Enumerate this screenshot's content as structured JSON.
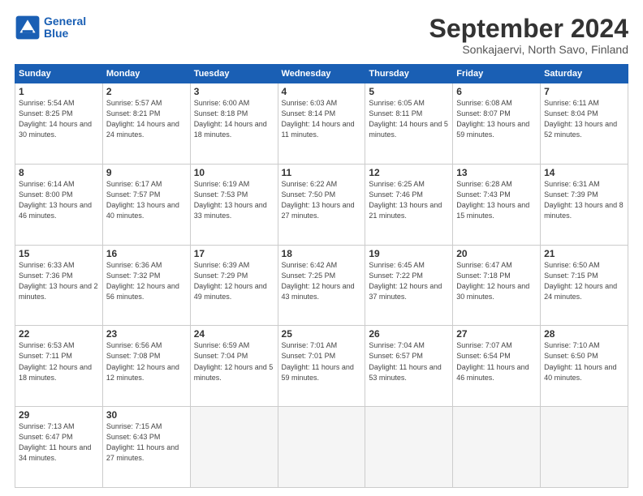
{
  "header": {
    "logo_line1": "General",
    "logo_line2": "Blue",
    "month": "September 2024",
    "location": "Sonkajaervi, North Savo, Finland"
  },
  "weekdays": [
    "Sunday",
    "Monday",
    "Tuesday",
    "Wednesday",
    "Thursday",
    "Friday",
    "Saturday"
  ],
  "days": [
    {
      "num": "1",
      "sunrise": "Sunrise: 5:54 AM",
      "sunset": "Sunset: 8:25 PM",
      "daylight": "Daylight: 14 hours and 30 minutes."
    },
    {
      "num": "2",
      "sunrise": "Sunrise: 5:57 AM",
      "sunset": "Sunset: 8:21 PM",
      "daylight": "Daylight: 14 hours and 24 minutes."
    },
    {
      "num": "3",
      "sunrise": "Sunrise: 6:00 AM",
      "sunset": "Sunset: 8:18 PM",
      "daylight": "Daylight: 14 hours and 18 minutes."
    },
    {
      "num": "4",
      "sunrise": "Sunrise: 6:03 AM",
      "sunset": "Sunset: 8:14 PM",
      "daylight": "Daylight: 14 hours and 11 minutes."
    },
    {
      "num": "5",
      "sunrise": "Sunrise: 6:05 AM",
      "sunset": "Sunset: 8:11 PM",
      "daylight": "Daylight: 14 hours and 5 minutes."
    },
    {
      "num": "6",
      "sunrise": "Sunrise: 6:08 AM",
      "sunset": "Sunset: 8:07 PM",
      "daylight": "Daylight: 13 hours and 59 minutes."
    },
    {
      "num": "7",
      "sunrise": "Sunrise: 6:11 AM",
      "sunset": "Sunset: 8:04 PM",
      "daylight": "Daylight: 13 hours and 52 minutes."
    },
    {
      "num": "8",
      "sunrise": "Sunrise: 6:14 AM",
      "sunset": "Sunset: 8:00 PM",
      "daylight": "Daylight: 13 hours and 46 minutes."
    },
    {
      "num": "9",
      "sunrise": "Sunrise: 6:17 AM",
      "sunset": "Sunset: 7:57 PM",
      "daylight": "Daylight: 13 hours and 40 minutes."
    },
    {
      "num": "10",
      "sunrise": "Sunrise: 6:19 AM",
      "sunset": "Sunset: 7:53 PM",
      "daylight": "Daylight: 13 hours and 33 minutes."
    },
    {
      "num": "11",
      "sunrise": "Sunrise: 6:22 AM",
      "sunset": "Sunset: 7:50 PM",
      "daylight": "Daylight: 13 hours and 27 minutes."
    },
    {
      "num": "12",
      "sunrise": "Sunrise: 6:25 AM",
      "sunset": "Sunset: 7:46 PM",
      "daylight": "Daylight: 13 hours and 21 minutes."
    },
    {
      "num": "13",
      "sunrise": "Sunrise: 6:28 AM",
      "sunset": "Sunset: 7:43 PM",
      "daylight": "Daylight: 13 hours and 15 minutes."
    },
    {
      "num": "14",
      "sunrise": "Sunrise: 6:31 AM",
      "sunset": "Sunset: 7:39 PM",
      "daylight": "Daylight: 13 hours and 8 minutes."
    },
    {
      "num": "15",
      "sunrise": "Sunrise: 6:33 AM",
      "sunset": "Sunset: 7:36 PM",
      "daylight": "Daylight: 13 hours and 2 minutes."
    },
    {
      "num": "16",
      "sunrise": "Sunrise: 6:36 AM",
      "sunset": "Sunset: 7:32 PM",
      "daylight": "Daylight: 12 hours and 56 minutes."
    },
    {
      "num": "17",
      "sunrise": "Sunrise: 6:39 AM",
      "sunset": "Sunset: 7:29 PM",
      "daylight": "Daylight: 12 hours and 49 minutes."
    },
    {
      "num": "18",
      "sunrise": "Sunrise: 6:42 AM",
      "sunset": "Sunset: 7:25 PM",
      "daylight": "Daylight: 12 hours and 43 minutes."
    },
    {
      "num": "19",
      "sunrise": "Sunrise: 6:45 AM",
      "sunset": "Sunset: 7:22 PM",
      "daylight": "Daylight: 12 hours and 37 minutes."
    },
    {
      "num": "20",
      "sunrise": "Sunrise: 6:47 AM",
      "sunset": "Sunset: 7:18 PM",
      "daylight": "Daylight: 12 hours and 30 minutes."
    },
    {
      "num": "21",
      "sunrise": "Sunrise: 6:50 AM",
      "sunset": "Sunset: 7:15 PM",
      "daylight": "Daylight: 12 hours and 24 minutes."
    },
    {
      "num": "22",
      "sunrise": "Sunrise: 6:53 AM",
      "sunset": "Sunset: 7:11 PM",
      "daylight": "Daylight: 12 hours and 18 minutes."
    },
    {
      "num": "23",
      "sunrise": "Sunrise: 6:56 AM",
      "sunset": "Sunset: 7:08 PM",
      "daylight": "Daylight: 12 hours and 12 minutes."
    },
    {
      "num": "24",
      "sunrise": "Sunrise: 6:59 AM",
      "sunset": "Sunset: 7:04 PM",
      "daylight": "Daylight: 12 hours and 5 minutes."
    },
    {
      "num": "25",
      "sunrise": "Sunrise: 7:01 AM",
      "sunset": "Sunset: 7:01 PM",
      "daylight": "Daylight: 11 hours and 59 minutes."
    },
    {
      "num": "26",
      "sunrise": "Sunrise: 7:04 AM",
      "sunset": "Sunset: 6:57 PM",
      "daylight": "Daylight: 11 hours and 53 minutes."
    },
    {
      "num": "27",
      "sunrise": "Sunrise: 7:07 AM",
      "sunset": "Sunset: 6:54 PM",
      "daylight": "Daylight: 11 hours and 46 minutes."
    },
    {
      "num": "28",
      "sunrise": "Sunrise: 7:10 AM",
      "sunset": "Sunset: 6:50 PM",
      "daylight": "Daylight: 11 hours and 40 minutes."
    },
    {
      "num": "29",
      "sunrise": "Sunrise: 7:13 AM",
      "sunset": "Sunset: 6:47 PM",
      "daylight": "Daylight: 11 hours and 34 minutes."
    },
    {
      "num": "30",
      "sunrise": "Sunrise: 7:15 AM",
      "sunset": "Sunset: 6:43 PM",
      "daylight": "Daylight: 11 hours and 27 minutes."
    }
  ]
}
